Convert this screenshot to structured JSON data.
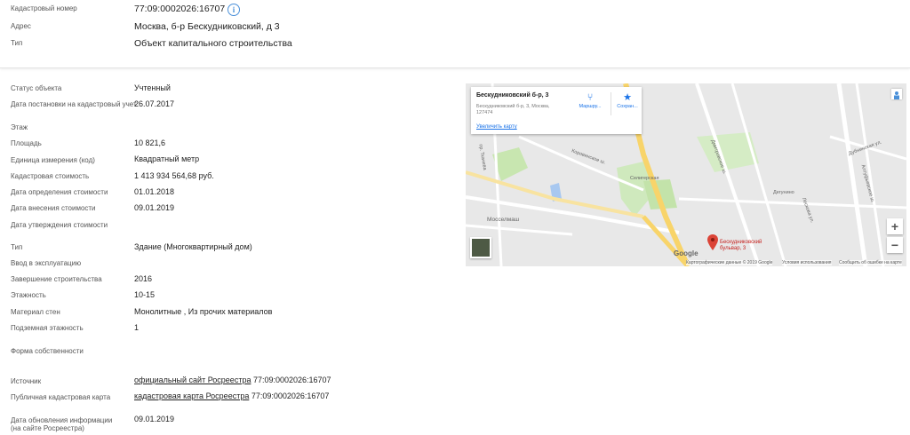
{
  "header_block": {
    "cadastral_number": {
      "label": "Кадастровый номер",
      "value": "77:09:0002026:16707"
    },
    "address": {
      "label": "Адрес",
      "value": "Москва, б-р Бескудниковский, д 3"
    },
    "type": {
      "label": "Тип",
      "value": "Объект капитального строительства"
    }
  },
  "details": {
    "status": {
      "label": "Статус объекта",
      "value": "Учтенный"
    },
    "registration_date": {
      "label": "Дата постановки на кадастровый учет",
      "value": "26.07.2017"
    },
    "floor": {
      "label": "Этаж",
      "value": ""
    },
    "area": {
      "label": "Площадь",
      "value": "10 821,6"
    },
    "unit": {
      "label": "Единица измерения (код)",
      "value": "Квадратный метр"
    },
    "cadastral_value": {
      "label": "Кадастровая стоимость",
      "value": "1 413 934 564,68 руб."
    },
    "value_date": {
      "label": "Дата определения стоимости",
      "value": "01.01.2018"
    },
    "value_entry_date": {
      "label": "Дата внесения стоимости",
      "value": "09.01.2019"
    },
    "value_approval_date": {
      "label": "Дата утверждения стоимости",
      "value": ""
    },
    "object_type": {
      "label": "Тип",
      "value": "Здание (Многоквартирный дом)"
    },
    "commissioning": {
      "label": "Ввод в эксплуатацию",
      "value": ""
    },
    "completion": {
      "label": "Завершение строительства",
      "value": "2016"
    },
    "floors": {
      "label": "Этажность",
      "value": "10-15"
    },
    "wall_material": {
      "label": "Материал стен",
      "value": "Монолитные , Из прочих материалов"
    },
    "underground_floors": {
      "label": "Подземная этажность",
      "value": "1"
    },
    "ownership": {
      "label": "Форма собственности",
      "value": ""
    },
    "source": {
      "label": "Источник",
      "link": "официальный сайт Росреестра",
      "suffix": " 77:09:0002026:16707"
    },
    "public_map": {
      "label": "Публичная кадастровая карта",
      "link": "кадастровая карта Росреестра",
      "suffix": " 77:09:0002026:16707"
    },
    "update_date": {
      "label_line1": "Дата обновления информации",
      "label_line2": "(на сайте Росреестра)",
      "value": "09.01.2019"
    }
  },
  "map": {
    "card_title": "Бескудниковский б-р, 3",
    "card_address": "Бескудниковский б-р, 3, Москва, 127474",
    "card_link": "Увеличить карту",
    "route_label": "Маршру...",
    "save_label": "Сохран...",
    "marker_label_1": "Бескудниковский",
    "marker_label_2": "бульвар, 3",
    "station_1": "Селигерская",
    "station_2": "Мосселмаш",
    "station_3": "Дегунино",
    "street_1": "Коровинское ш.",
    "street_2": "Дмитровское ш.",
    "street_3": "Алтуфьевское ш.",
    "street_4": "Дубнинская ул.",
    "street_5": "Лескова ул.",
    "street_6": "пр. Ткачева",
    "zoom_in": "+",
    "zoom_out": "−",
    "google_logo": "Google",
    "attr_1": "Картографические данные © 2019 Google",
    "attr_2": "Условия использования",
    "attr_3": "Сообщить об ошибке на карте",
    "colors": {
      "park": "#c8e6b0",
      "road_major": "#f8d46a",
      "road": "#ffffff",
      "marker": "#db4437"
    }
  }
}
